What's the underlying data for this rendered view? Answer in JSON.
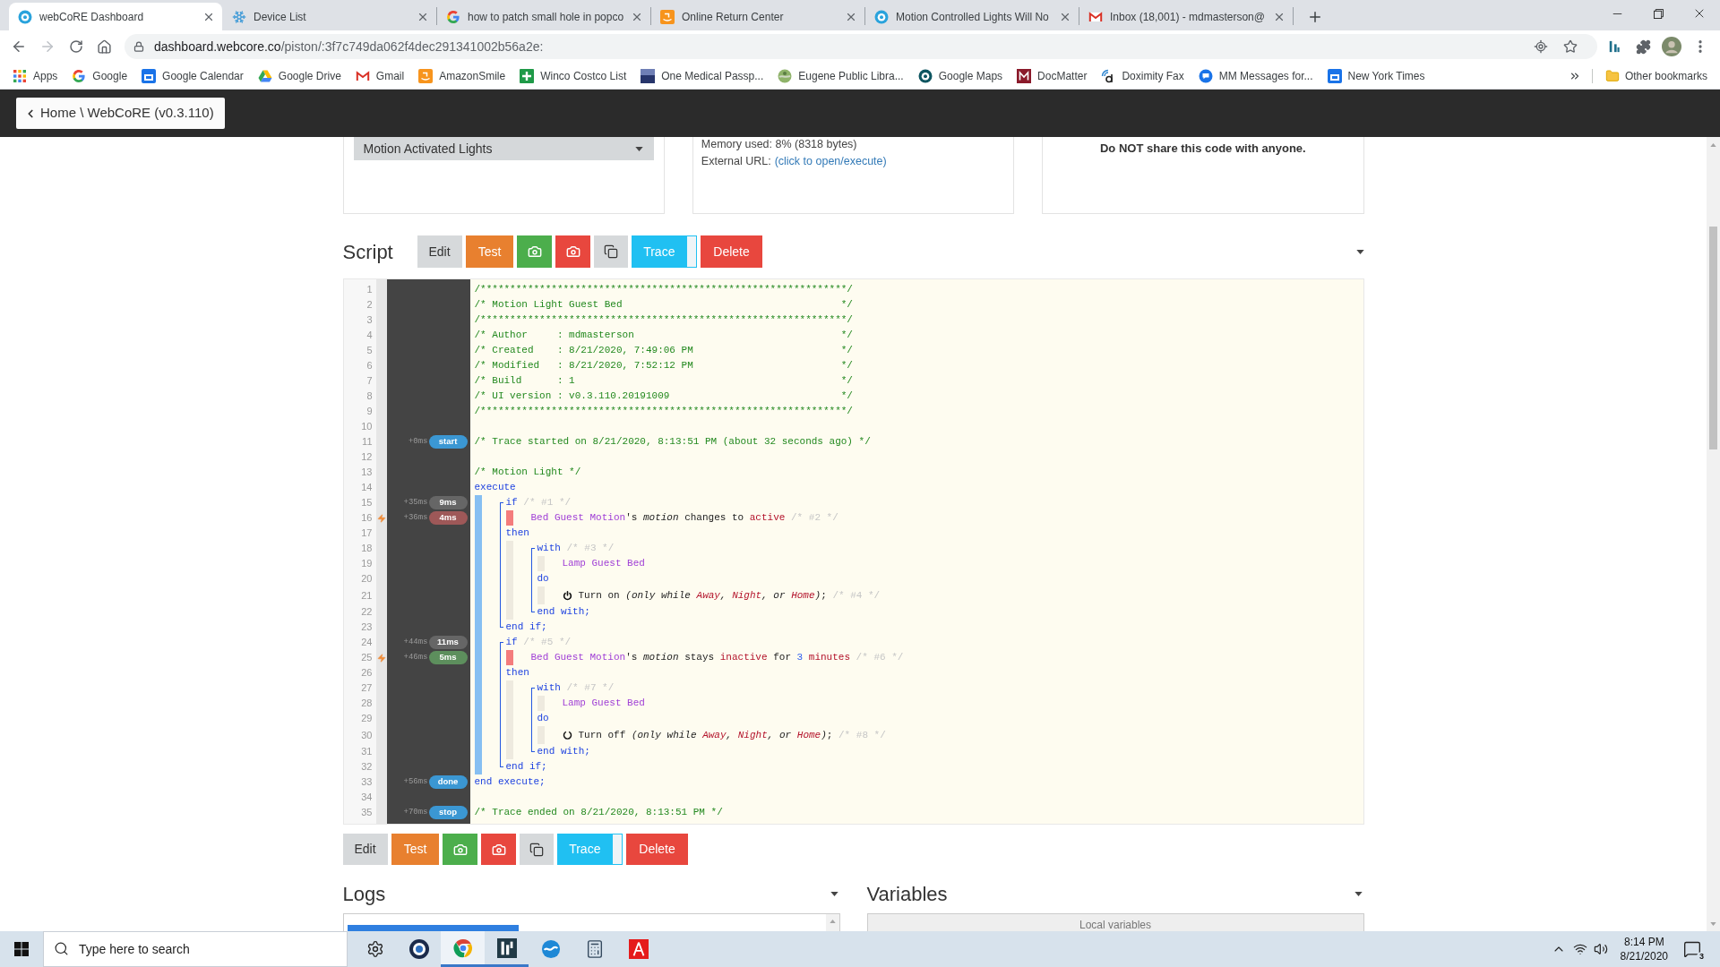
{
  "browser": {
    "tabs": [
      {
        "title": "webCoRE Dashboard",
        "selected": true
      },
      {
        "title": "Device List",
        "selected": false
      },
      {
        "title": "how to patch small hole in popco",
        "selected": false
      },
      {
        "title": "Online Return Center",
        "selected": false
      },
      {
        "title": "Motion Controlled Lights Will No",
        "selected": false
      },
      {
        "title": "Inbox (18,001) - mdmasterson@",
        "selected": false
      }
    ],
    "url": {
      "host": "dashboard.webcore.co",
      "path": "/piston/:3f7c749da062f4dec291341002b56a2e:"
    },
    "bookmarks": [
      {
        "label": "Apps"
      },
      {
        "label": "Google"
      },
      {
        "label": "Google Calendar"
      },
      {
        "label": "Google Drive"
      },
      {
        "label": "Gmail"
      },
      {
        "label": "AmazonSmile"
      },
      {
        "label": "Winco Costco List"
      },
      {
        "label": "One Medical Passp..."
      },
      {
        "label": "Eugene Public Libra..."
      },
      {
        "label": "Google Maps"
      },
      {
        "label": "DocMatter"
      },
      {
        "label": "Doximity Fax"
      },
      {
        "label": "MM Messages for..."
      },
      {
        "label": "New York Times"
      }
    ],
    "other_bookmarks": "Other bookmarks"
  },
  "header": {
    "home_button": "Home \\ WebCoRE (v0.3.110)"
  },
  "summary": {
    "piston_select": "Motion Activated Lights",
    "memory": "Memory used: 8% (8318 bytes)",
    "external_url": {
      "label": "External URL:",
      "link": "(click to open/execute)"
    },
    "warning": "Do NOT share this code with anyone."
  },
  "script": {
    "title": "Script",
    "toolbar_top": [
      {
        "kind": "edit",
        "label": "Edit",
        "color": "#d6d9db"
      },
      {
        "kind": "action",
        "label": "Test",
        "color": "#e8802f"
      },
      {
        "kind": "camera",
        "color": "#4cae4c"
      },
      {
        "kind": "camera",
        "color": "#e8473e"
      },
      {
        "kind": "copy",
        "color": "#d6d9db"
      },
      {
        "kind": "trace",
        "label": "Trace",
        "color": "#20c0f2"
      },
      {
        "kind": "action",
        "label": "Delete",
        "color": "#e8473e"
      }
    ],
    "code": [
      {
        "kind": "line",
        "number": "1",
        "tokens": [
          {
            "kind": "comment",
            "text": "/**************************************************************/"
          }
        ]
      },
      {
        "kind": "line",
        "number": "2",
        "tokens": [
          {
            "kind": "comment",
            "text": "/* Motion Light Guest Bed                                     */"
          }
        ]
      },
      {
        "kind": "line",
        "number": "3",
        "tokens": [
          {
            "kind": "comment",
            "text": "/**************************************************************/"
          }
        ]
      },
      {
        "kind": "line",
        "number": "4",
        "tokens": [
          {
            "kind": "comment",
            "text": "/* Author     : mdmasterson                                   */"
          }
        ]
      },
      {
        "kind": "line",
        "number": "5",
        "tokens": [
          {
            "kind": "comment",
            "text": "/* Created    : 8/21/2020, 7:49:06 PM                         */"
          }
        ]
      },
      {
        "kind": "line",
        "number": "6",
        "tokens": [
          {
            "kind": "comment",
            "text": "/* Modified   : 8/21/2020, 7:52:12 PM                         */"
          }
        ]
      },
      {
        "kind": "line",
        "number": "7",
        "tokens": [
          {
            "kind": "comment",
            "text": "/* Build      : 1                                             */"
          }
        ]
      },
      {
        "kind": "line",
        "number": "8",
        "tokens": [
          {
            "kind": "comment",
            "text": "/* UI version : v0.3.110.20191009                             */"
          }
        ]
      },
      {
        "kind": "line",
        "number": "9",
        "tokens": [
          {
            "kind": "comment",
            "text": "/**************************************************************/"
          }
        ]
      },
      {
        "kind": "line",
        "number": "10"
      },
      {
        "kind": "line",
        "number": "11",
        "tokens": [
          {
            "kind": "comment",
            "text": "/* Trace started on 8/21/2020, 8:13:51 PM (about 32 seconds ago) */"
          }
        ],
        "trace": {
          "offset": "+0ms",
          "badge": "start",
          "color": "#3b97d3",
          "flash": false
        }
      },
      {
        "kind": "line",
        "number": "12"
      },
      {
        "kind": "line",
        "number": "13",
        "tokens": [
          {
            "kind": "comment",
            "text": "/* Motion Light */"
          }
        ]
      },
      {
        "kind": "line",
        "number": "14",
        "tokens": [
          {
            "kind": "keyword",
            "text": "execute"
          }
        ]
      },
      {
        "kind": "body",
        "highlighted": true,
        "children": [
          {
            "kind": "bracket",
            "children": [
              {
                "kind": "line",
                "number": "15",
                "tokens": [
                  {
                    "kind": "keyword",
                    "text": "if"
                  },
                  {
                    "kind": "dim",
                    "text": " /* #1 */"
                  }
                ],
                "trace": {
                  "offset": "+35ms",
                  "badge": "9ms",
                  "color": "#666666",
                  "flash": false
                }
              },
              {
                "kind": "condition",
                "result": false,
                "children": [
                  {
                    "kind": "line",
                    "number": "16",
                    "tokens": [
                      {
                        "kind": "device",
                        "text": "Bed Guest Motion"
                      },
                      {
                        "kind": "plain",
                        "text": "'s "
                      },
                      {
                        "kind": "italic",
                        "text": "motion"
                      },
                      {
                        "kind": "plain",
                        "text": " changes to "
                      },
                      {
                        "kind": "value",
                        "text": "active"
                      },
                      {
                        "kind": "dim",
                        "text": " /* #2 */"
                      }
                    ],
                    "trace": {
                      "offset": "+36ms",
                      "badge": "4ms",
                      "color": "#9e5858",
                      "flash": true
                    }
                  }
                ]
              },
              {
                "kind": "line",
                "number": "17",
                "tokens": [
                  {
                    "kind": "keyword",
                    "text": "then"
                  }
                ]
              },
              {
                "kind": "body",
                "highlighted": false,
                "children": [
                  {
                    "kind": "bracket",
                    "children": [
                      {
                        "kind": "line",
                        "number": "18",
                        "tokens": [
                          {
                            "kind": "keyword",
                            "text": "with"
                          },
                          {
                            "kind": "dim",
                            "text": " /* #3 */"
                          }
                        ]
                      },
                      {
                        "kind": "body",
                        "highlighted": false,
                        "children": [
                          {
                            "kind": "line",
                            "number": "19",
                            "tokens": [
                              {
                                "kind": "device",
                                "text": "Lamp Guest Bed"
                              }
                            ]
                          }
                        ]
                      },
                      {
                        "kind": "line",
                        "number": "20",
                        "tokens": [
                          {
                            "kind": "keyword",
                            "text": "do"
                          }
                        ]
                      },
                      {
                        "kind": "body",
                        "highlighted": false,
                        "children": [
                          {
                            "kind": "line",
                            "number": "21",
                            "tokens": [
                              {
                                "kind": "power",
                                "on": true
                              },
                              {
                                "kind": "plain",
                                "text": "Turn on "
                              },
                              {
                                "kind": "italic",
                                "text": "(only while "
                              },
                              {
                                "kind": "value-italic",
                                "text": "Away"
                              },
                              {
                                "kind": "italic",
                                "text": ", "
                              },
                              {
                                "kind": "value-italic",
                                "text": "Night"
                              },
                              {
                                "kind": "italic",
                                "text": ", or "
                              },
                              {
                                "kind": "value-italic",
                                "text": "Home"
                              },
                              {
                                "kind": "italic",
                                "text": ")"
                              },
                              {
                                "kind": "plain",
                                "text": ";"
                              },
                              {
                                "kind": "dim",
                                "text": " /* #4 */"
                              }
                            ]
                          }
                        ]
                      },
                      {
                        "kind": "line",
                        "number": "22",
                        "tokens": [
                          {
                            "kind": "keyword",
                            "text": "end with;"
                          }
                        ]
                      }
                    ]
                  }
                ]
              },
              {
                "kind": "line",
                "number": "23",
                "tokens": [
                  {
                    "kind": "keyword",
                    "text": "end if;"
                  }
                ]
              }
            ]
          },
          {
            "kind": "bracket",
            "children": [
              {
                "kind": "line",
                "number": "24",
                "tokens": [
                  {
                    "kind": "keyword",
                    "text": "if"
                  },
                  {
                    "kind": "dim",
                    "text": " /* #5 */"
                  }
                ],
                "trace": {
                  "offset": "+44ms",
                  "badge": "11ms",
                  "color": "#666666",
                  "flash": false
                }
              },
              {
                "kind": "condition",
                "result": false,
                "children": [
                  {
                    "kind": "line",
                    "number": "25",
                    "tokens": [
                      {
                        "kind": "device",
                        "text": "Bed Guest Motion"
                      },
                      {
                        "kind": "plain",
                        "text": "'s "
                      },
                      {
                        "kind": "italic",
                        "text": "motion"
                      },
                      {
                        "kind": "plain",
                        "text": " stays "
                      },
                      {
                        "kind": "value",
                        "text": "inactive"
                      },
                      {
                        "kind": "plain",
                        "text": " for "
                      },
                      {
                        "kind": "number",
                        "text": "3"
                      },
                      {
                        "kind": "value",
                        "text": " minutes"
                      },
                      {
                        "kind": "dim",
                        "text": " /* #6 */"
                      }
                    ],
                    "trace": {
                      "offset": "+46ms",
                      "badge": "5ms",
                      "color": "#5d8f5d",
                      "flash": true
                    }
                  }
                ]
              },
              {
                "kind": "line",
                "number": "26",
                "tokens": [
                  {
                    "kind": "keyword",
                    "text": "then"
                  }
                ]
              },
              {
                "kind": "body",
                "highlighted": false,
                "children": [
                  {
                    "kind": "bracket",
                    "children": [
                      {
                        "kind": "line",
                        "number": "27",
                        "tokens": [
                          {
                            "kind": "keyword",
                            "text": "with"
                          },
                          {
                            "kind": "dim",
                            "text": " /* #7 */"
                          }
                        ]
                      },
                      {
                        "kind": "body",
                        "highlighted": false,
                        "children": [
                          {
                            "kind": "line",
                            "number": "28",
                            "tokens": [
                              {
                                "kind": "device",
                                "text": "Lamp Guest Bed"
                              }
                            ]
                          }
                        ]
                      },
                      {
                        "kind": "line",
                        "number": "29",
                        "tokens": [
                          {
                            "kind": "keyword",
                            "text": "do"
                          }
                        ]
                      },
                      {
                        "kind": "body",
                        "highlighted": false,
                        "children": [
                          {
                            "kind": "line",
                            "number": "30",
                            "tokens": [
                              {
                                "kind": "power",
                                "on": false
                              },
                              {
                                "kind": "plain",
                                "text": "Turn off "
                              },
                              {
                                "kind": "italic",
                                "text": "(only while "
                              },
                              {
                                "kind": "value-italic",
                                "text": "Away"
                              },
                              {
                                "kind": "italic",
                                "text": ", "
                              },
                              {
                                "kind": "value-italic",
                                "text": "Night"
                              },
                              {
                                "kind": "italic",
                                "text": ", or "
                              },
                              {
                                "kind": "value-italic",
                                "text": "Home"
                              },
                              {
                                "kind": "italic",
                                "text": ")"
                              },
                              {
                                "kind": "plain",
                                "text": ";"
                              },
                              {
                                "kind": "dim",
                                "text": " /* #8 */"
                              }
                            ]
                          }
                        ]
                      },
                      {
                        "kind": "line",
                        "number": "31",
                        "tokens": [
                          {
                            "kind": "keyword",
                            "text": "end with;"
                          }
                        ]
                      }
                    ]
                  }
                ]
              },
              {
                "kind": "line",
                "number": "32",
                "tokens": [
                  {
                    "kind": "keyword",
                    "text": "end if;"
                  }
                ]
              }
            ]
          }
        ]
      },
      {
        "kind": "line",
        "number": "33",
        "tokens": [
          {
            "kind": "keyword",
            "text": "end execute;"
          }
        ],
        "trace": {
          "offset": "+56ms",
          "badge": "done",
          "color": "#3b97d3",
          "flash": false
        }
      },
      {
        "kind": "line",
        "number": "34"
      },
      {
        "kind": "line",
        "number": "35",
        "tokens": [
          {
            "kind": "comment",
            "text": "/* Trace ended on 8/21/2020, 8:13:51 PM */"
          }
        ],
        "trace": {
          "offset": "+70ms",
          "badge": "stop",
          "color": "#3b97d3",
          "flash": false
        }
      }
    ],
    "toolbar_bottom": [
      {
        "kind": "edit",
        "label": "Edit",
        "color": "#d6d9db"
      },
      {
        "kind": "action",
        "label": "Test",
        "color": "#e8802f"
      },
      {
        "kind": "camera",
        "color": "#4cae4c"
      },
      {
        "kind": "camera",
        "color": "#e8473e"
      },
      {
        "kind": "copy",
        "color": "#d6d9db"
      },
      {
        "kind": "trace",
        "label": "Trace",
        "color": "#20c0f2"
      },
      {
        "kind": "action",
        "label": "Delete",
        "color": "#e8473e"
      }
    ]
  },
  "logs": {
    "title": "Logs",
    "rows": [
      {
        "selected": true
      }
    ]
  },
  "variables": {
    "title": "Variables",
    "header": "Local variables"
  },
  "taskbar": {
    "search": {
      "placeholder": "Type here to search"
    },
    "time": "8:14 PM",
    "date": "8/21/2020",
    "notifications": "3"
  }
}
